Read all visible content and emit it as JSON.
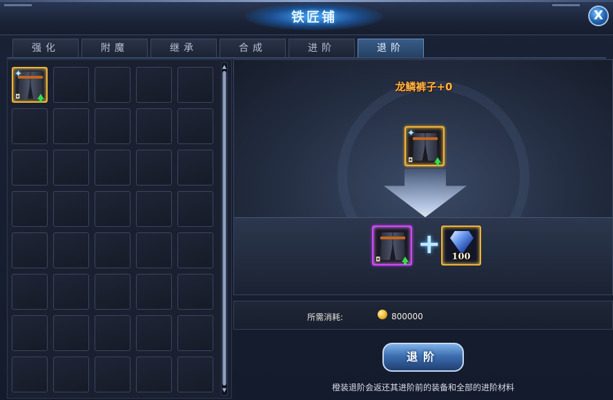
{
  "window": {
    "title": "铁匠铺",
    "close_label": "X"
  },
  "tabs": [
    {
      "label": "强化",
      "active": false
    },
    {
      "label": "附魔",
      "active": false
    },
    {
      "label": "继承",
      "active": false
    },
    {
      "label": "合成",
      "active": false
    },
    {
      "label": "进阶",
      "active": false
    },
    {
      "label": "退阶",
      "active": true
    }
  ],
  "inventory": {
    "rows": 8,
    "columns": 5,
    "occupied_slots": [
      {
        "index": 0,
        "item": "pants-icon",
        "rarity": "gold",
        "upgrade_arrow": true
      }
    ]
  },
  "retreat_panel": {
    "item_name": "龙鳞裤子+0",
    "source_item": {
      "icon": "pants-icon",
      "rarity": "gold"
    },
    "result_item": {
      "icon": "pants-icon",
      "rarity": "purple"
    },
    "material": {
      "icon": "blue-gem-icon",
      "count": "100"
    }
  },
  "cost": {
    "label": "所需消耗:",
    "value": "800000",
    "icon": "gold-coin-icon"
  },
  "action_button": {
    "label": "退阶"
  },
  "hint": "橙装退阶会返还其进阶前的装备和全部的进阶材料",
  "colors": {
    "rarity_gold": "#f0b437",
    "rarity_purple": "#d247ff",
    "name_orange": "#ffb347",
    "title_glow": "#3fb1ff"
  }
}
